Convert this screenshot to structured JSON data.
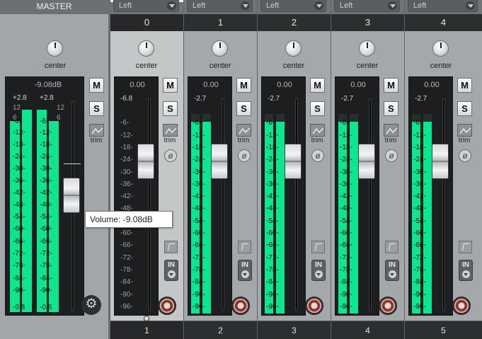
{
  "master": {
    "title": "MASTER",
    "pan_label": "center",
    "volume_readout": "-9.08dB",
    "peak_left": "+2.8",
    "peak_right": "+2.8",
    "meter_left": "-0.8",
    "meter_right": "-0.6",
    "scale": [
      "12",
      "6",
      "-6-",
      "-12-",
      "-18-",
      "-24-",
      "-30-",
      "-36-",
      "-42-",
      "-48-",
      "-54-",
      "-60-",
      "-66-",
      "-72-",
      "-78-",
      "-84-",
      "-90-"
    ],
    "mute_label": "M",
    "solo_label": "S",
    "trim_label": "trim",
    "fader_level": 0.6
  },
  "tooltip": {
    "text": "Volume: -9.08dB"
  },
  "tracks": [
    {
      "io": "Left",
      "number": "0",
      "label": "1",
      "pan_label": "center",
      "volume_readout": "0.00",
      "peak": "-6.8",
      "mute_label": "M",
      "solo_label": "S",
      "trim_label": "trim",
      "phase_symbol": "ø",
      "in_label": "IN",
      "meter_level": 0,
      "selected": true
    },
    {
      "io": "Left",
      "number": "1",
      "label": "2",
      "pan_label": "center",
      "volume_readout": "0.00",
      "peak": "-2.7",
      "mute_label": "M",
      "solo_label": "S",
      "trim_label": "trim",
      "phase_symbol": "ø",
      "in_label": "IN",
      "meter_level": 0.96,
      "selected": false
    },
    {
      "io": "Left",
      "number": "2",
      "label": "3",
      "pan_label": "center",
      "volume_readout": "0.00",
      "peak": "-2.7",
      "mute_label": "M",
      "solo_label": "S",
      "trim_label": "trim",
      "phase_symbol": "ø",
      "in_label": "IN",
      "meter_level": 0.96,
      "selected": false
    },
    {
      "io": "Left",
      "number": "3",
      "label": "4",
      "pan_label": "center",
      "volume_readout": "0.00",
      "peak": "-2.7",
      "mute_label": "M",
      "solo_label": "S",
      "trim_label": "trim",
      "phase_symbol": "ø",
      "in_label": "IN",
      "meter_level": 0.96,
      "selected": false
    },
    {
      "io": "Left",
      "number": "4",
      "label": "5",
      "pan_label": "center",
      "volume_readout": "0.00",
      "peak": "-2.7",
      "mute_label": "M",
      "solo_label": "S",
      "trim_label": "trim",
      "phase_symbol": "ø",
      "in_label": "IN",
      "meter_level": 0.96,
      "selected": false
    }
  ],
  "track_scale": [
    "-6-",
    "-12-",
    "-18-",
    "-24-",
    "-30-",
    "-36-",
    "-42-",
    "-48-",
    "-54-",
    "-60-",
    "-66-",
    "-72-",
    "-78-",
    "-84-",
    "-90-",
    "-96-"
  ],
  "colors": {
    "meter": "#0be68f",
    "arm": "#8a3427",
    "panel": "#1c1e1f"
  }
}
